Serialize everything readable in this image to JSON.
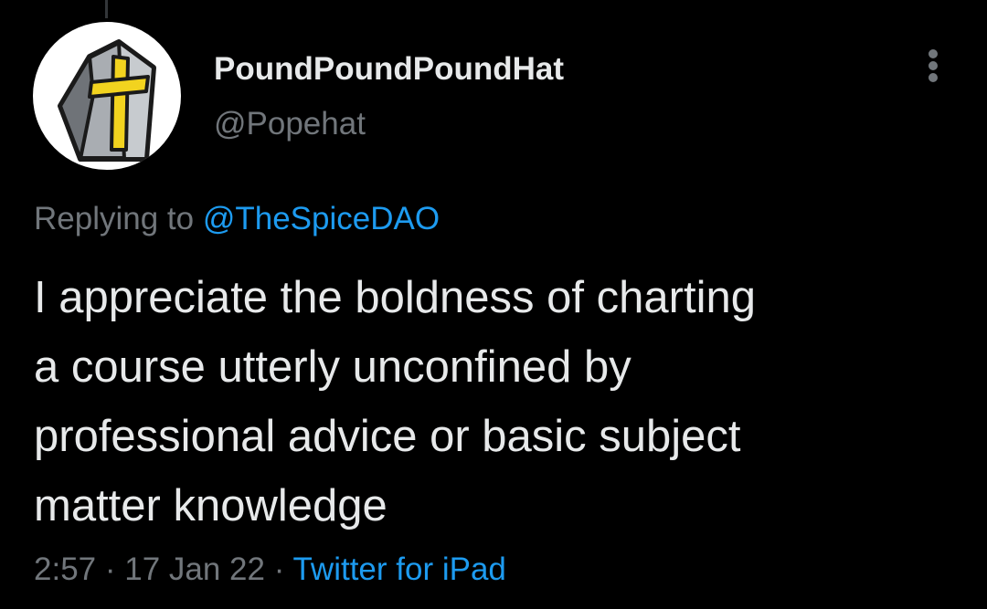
{
  "tweet": {
    "author": {
      "display_name": "PoundPoundPoundHat",
      "handle": "@Popehat"
    },
    "reply": {
      "prefix": "Replying to",
      "mention": "@TheSpiceDAO"
    },
    "text_lines": [
      "I appreciate the boldness of charting",
      "a course utterly unconfined by",
      "professional advice or basic subject",
      "matter knowledge"
    ],
    "meta": {
      "time": "2:57",
      "separator": "·",
      "date": "17 Jan 22",
      "source": "Twitter for iPad"
    }
  },
  "icons": {
    "avatar": "mitre-hat-icon",
    "more": "more-options-icon"
  },
  "colors": {
    "background": "#000000",
    "text_primary": "#e7e9ea",
    "text_secondary": "#71767b",
    "link": "#1d9bf0",
    "avatar_cross": "#f2d31f"
  }
}
